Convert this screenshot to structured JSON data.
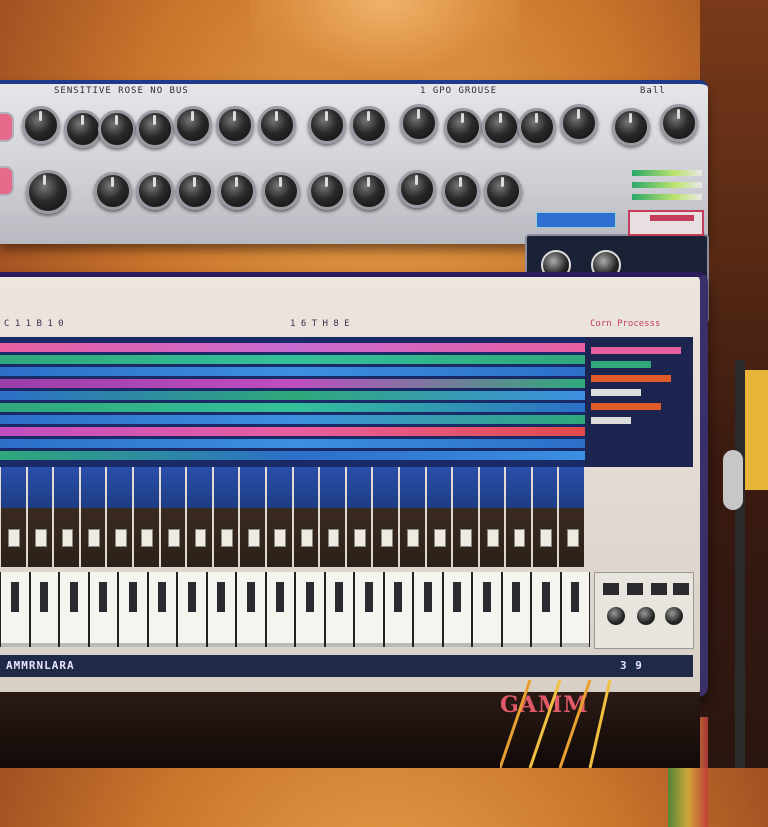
{
  "scene": {
    "description_labels": {
      "rack_top_left": "SENSITIVE ROSE NO BUS",
      "rack_top_mid": "1 GPO GROUSE",
      "rack_top_right": "Ball",
      "mixer_left_label": "C 1 1 B 1 0",
      "mixer_mid_label": "1 6 T H 8 E",
      "mixer_right_label": "Corn Processs",
      "bottom_left_label": "AMMRNLARA",
      "bottom_right_label": "3 9",
      "brand_logo": "GAMM"
    },
    "colors": {
      "accent_blue": "#203a8a",
      "accent_pink": "#c53b5a",
      "screen_bg": "#1a2a66",
      "warm_bg": "#c9752c"
    }
  }
}
